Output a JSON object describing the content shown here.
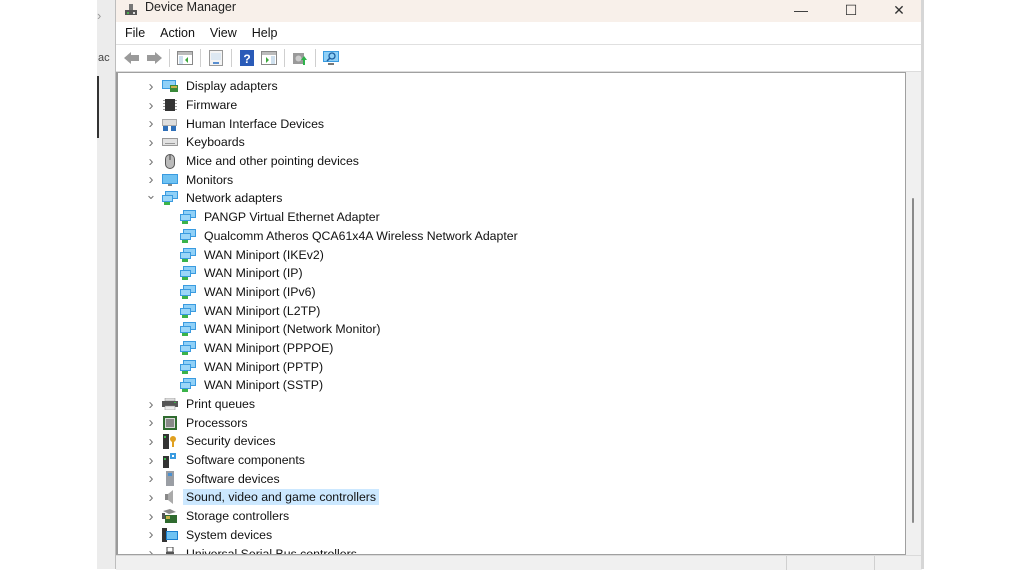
{
  "background": {
    "nav_arrow": "›",
    "partial_text": "ac"
  },
  "window": {
    "title": "Device Manager",
    "controls": {
      "minimize": "—",
      "maximize": "☐",
      "close": "✕"
    }
  },
  "menubar": {
    "items": [
      "File",
      "Action",
      "View",
      "Help"
    ]
  },
  "toolbar": {
    "buttons": [
      "back-icon",
      "forward-icon",
      "show-hide-console-tree-icon",
      "properties-icon",
      "help-icon",
      "show-action-pane-icon",
      "update-driver-icon",
      "scan-hardware-icon"
    ]
  },
  "tree": {
    "items": [
      {
        "label": "Display adapters",
        "icon": "display-adapter-icon",
        "expanded": false,
        "level": 1
      },
      {
        "label": "Firmware",
        "icon": "firmware-icon",
        "expanded": false,
        "level": 1
      },
      {
        "label": "Human Interface Devices",
        "icon": "hid-icon",
        "expanded": false,
        "level": 1
      },
      {
        "label": "Keyboards",
        "icon": "keyboard-icon",
        "expanded": false,
        "level": 1
      },
      {
        "label": "Mice and other pointing devices",
        "icon": "mouse-icon",
        "expanded": false,
        "level": 1
      },
      {
        "label": "Monitors",
        "icon": "monitor-icon",
        "expanded": false,
        "level": 1
      },
      {
        "label": "Network adapters",
        "icon": "network-adapter-icon",
        "expanded": true,
        "level": 1
      },
      {
        "label": "PANGP Virtual Ethernet Adapter",
        "icon": "network-adapter-icon",
        "level": 2
      },
      {
        "label": "Qualcomm Atheros QCA61x4A Wireless Network Adapter",
        "icon": "network-adapter-icon",
        "level": 2
      },
      {
        "label": "WAN Miniport (IKEv2)",
        "icon": "network-adapter-icon",
        "level": 2
      },
      {
        "label": "WAN Miniport (IP)",
        "icon": "network-adapter-icon",
        "level": 2
      },
      {
        "label": "WAN Miniport (IPv6)",
        "icon": "network-adapter-icon",
        "level": 2
      },
      {
        "label": "WAN Miniport (L2TP)",
        "icon": "network-adapter-icon",
        "level": 2
      },
      {
        "label": "WAN Miniport (Network Monitor)",
        "icon": "network-adapter-icon",
        "level": 2
      },
      {
        "label": "WAN Miniport (PPPOE)",
        "icon": "network-adapter-icon",
        "level": 2
      },
      {
        "label": "WAN Miniport (PPTP)",
        "icon": "network-adapter-icon",
        "level": 2
      },
      {
        "label": "WAN Miniport (SSTP)",
        "icon": "network-adapter-icon",
        "level": 2
      },
      {
        "label": "Print queues",
        "icon": "printer-icon",
        "expanded": false,
        "level": 1
      },
      {
        "label": "Processors",
        "icon": "processor-icon",
        "expanded": false,
        "level": 1
      },
      {
        "label": "Security devices",
        "icon": "security-device-icon",
        "expanded": false,
        "level": 1
      },
      {
        "label": "Software components",
        "icon": "software-component-icon",
        "expanded": false,
        "level": 1
      },
      {
        "label": "Software devices",
        "icon": "software-device-icon",
        "expanded": false,
        "level": 1
      },
      {
        "label": "Sound, video and game controllers",
        "icon": "speaker-icon",
        "expanded": false,
        "level": 1,
        "selected": true
      },
      {
        "label": "Storage controllers",
        "icon": "storage-controller-icon",
        "expanded": false,
        "level": 1
      },
      {
        "label": "System devices",
        "icon": "system-devices-icon",
        "expanded": false,
        "level": 1
      },
      {
        "label": "Universal Serial Bus controllers",
        "icon": "usb-icon",
        "expanded": false,
        "level": 1
      }
    ]
  },
  "colors": {
    "titlebar": "#f8f0ea",
    "selection": "#cce8ff",
    "accent": "#2f8fd8"
  }
}
